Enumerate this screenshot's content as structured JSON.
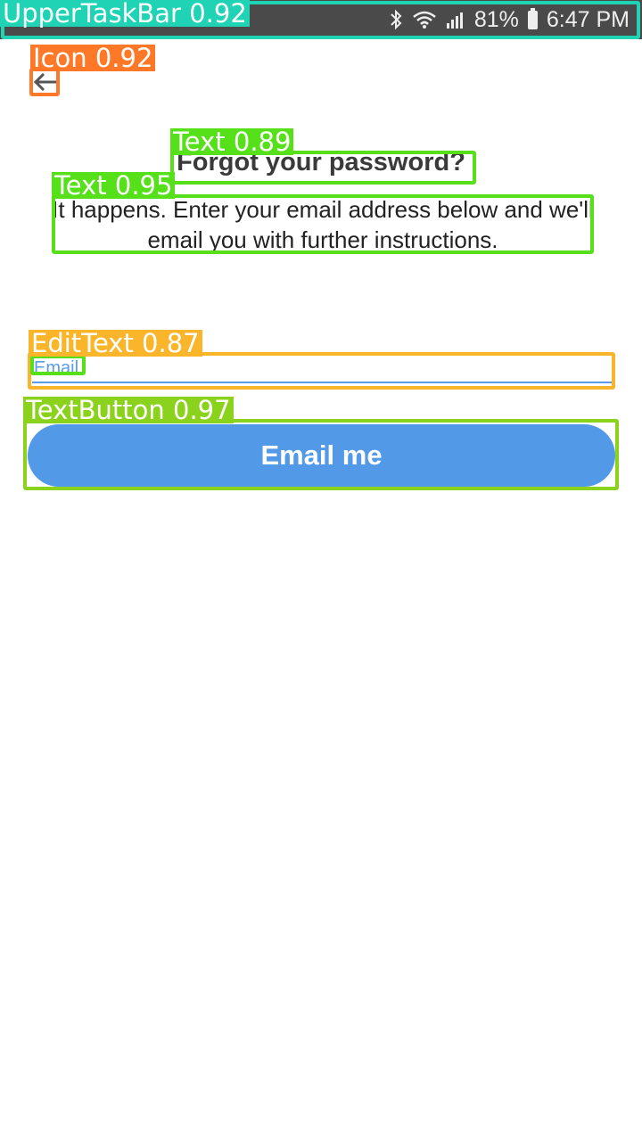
{
  "status_bar": {
    "battery_percent": "81%",
    "time": "6:47 PM"
  },
  "screen": {
    "title": "Forgot your password?",
    "subtitle": "It happens. Enter your email address below and we'll email you with further instructions.",
    "email_placeholder": "Email",
    "submit_label": "Email me"
  },
  "detections": [
    {
      "label": "UpperTaskBar 0.92",
      "color": "#1fd3b4"
    },
    {
      "label": "Icon 0.92",
      "color": "#ff7828"
    },
    {
      "label": "Text 0.89",
      "color": "#55e01a"
    },
    {
      "label": "Text 0.95",
      "color": "#55e01a"
    },
    {
      "label": "EditText 0.87",
      "color": "#fbb52a"
    },
    {
      "label": "TextButton 0.97",
      "color": "#8bd21c"
    }
  ],
  "colors": {
    "accent": "#5299e8",
    "status_bar": "#4a4a4a"
  }
}
